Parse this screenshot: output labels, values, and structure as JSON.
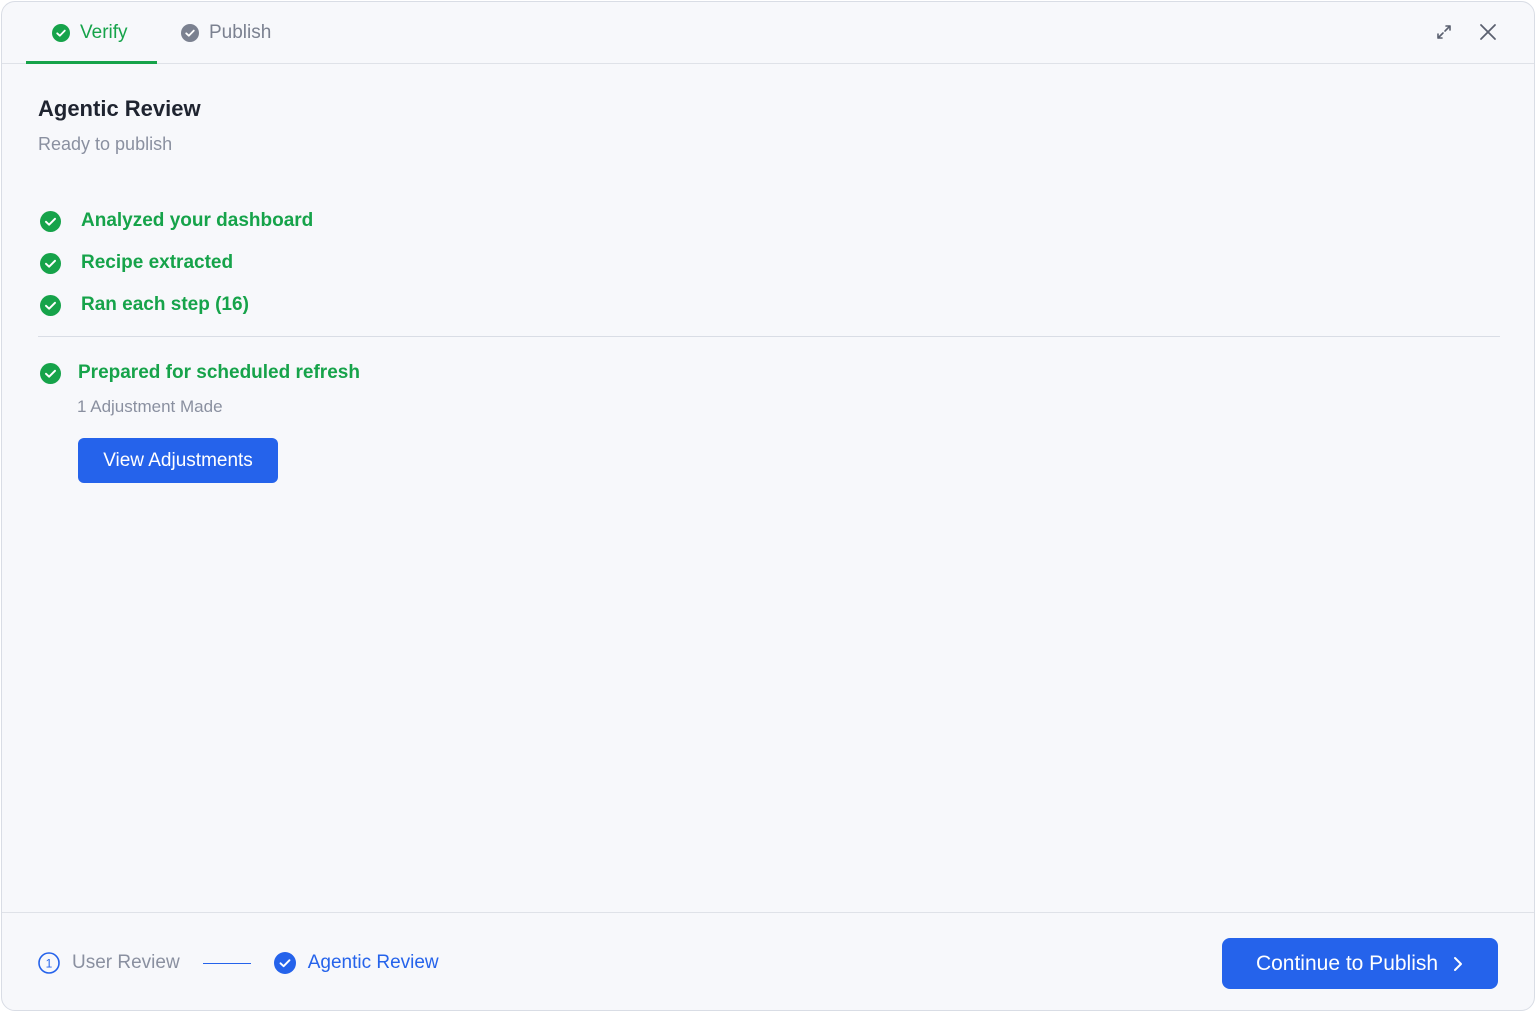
{
  "header": {
    "tabs": [
      {
        "label": "Verify",
        "state": "complete",
        "active": true
      },
      {
        "label": "Publish",
        "state": "pending",
        "active": false
      }
    ],
    "actions": [
      {
        "icon": "expand-icon"
      },
      {
        "icon": "close-icon"
      }
    ]
  },
  "main": {
    "title": "Agentic Review",
    "subtitle": "Ready to publish",
    "checks": [
      {
        "label": "Analyzed your dashboard",
        "icon": "check-circle-icon"
      },
      {
        "label": "Recipe extracted",
        "icon": "check-circle-icon"
      },
      {
        "label": "Ran each step (16)",
        "icon": "check-circle-icon"
      }
    ],
    "prepared": {
      "label": "Prepared for scheduled refresh",
      "note": "1 Adjustment Made",
      "button": "View Adjustments"
    }
  },
  "footer": {
    "steps": [
      {
        "number": "1",
        "label": "User Review",
        "state": "pending"
      },
      {
        "label": "Agentic Review",
        "state": "complete"
      }
    ],
    "continue_label": "Continue to Publish"
  },
  "colors": {
    "success": "#16a34a",
    "primary": "#2563eb",
    "muted": "#8a90a0",
    "background": "#f7f8fb"
  }
}
